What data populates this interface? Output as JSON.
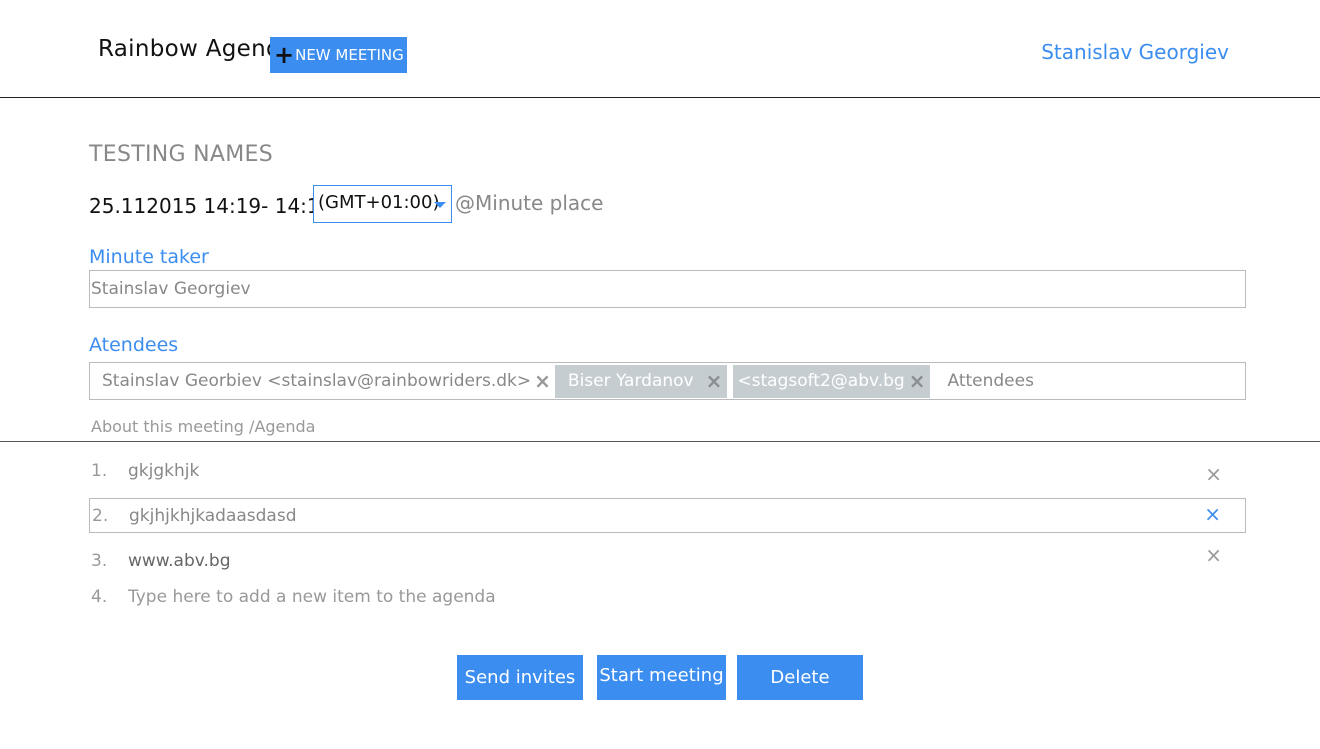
{
  "header": {
    "brand": "Rainbow Agenda",
    "new_meeting_label": "NEW MEETING",
    "user_name": "Stanislav Georgiev"
  },
  "meeting": {
    "title": "TESTING NAMES",
    "datetime": "25.112015 14:19- 14:19",
    "timezone": "(GMT+01:00)",
    "place": "@Minute place"
  },
  "minute_taker": {
    "label": "Minute taker",
    "value": "Stainslav Georgiev"
  },
  "attendees": {
    "label": "Atendees",
    "tags": [
      {
        "text": "Stainslav Georbiev <stainslav@rainbowriders.dk>",
        "style": "plain"
      },
      {
        "text": "Biser Yardanov",
        "style": "gray"
      },
      {
        "text": "<stagsoft2@abv.bg",
        "style": "gray"
      }
    ],
    "placeholder": "Attendees",
    "remove_glyph": "×"
  },
  "agenda": {
    "label": "About this meeting /Agenda",
    "items": [
      {
        "num": "1.",
        "text": "gkjgkhjk"
      },
      {
        "num": "2.",
        "text": "gkjhjkhjkadaasdasd"
      },
      {
        "num": "3.",
        "text": "www.abv.bg"
      }
    ],
    "new_item": {
      "num": "4.",
      "placeholder": "Type here to add a new item to the agenda"
    },
    "remove_glyph": "×"
  },
  "actions": {
    "send_invites": "Send invites",
    "start_meeting": "Start meeting",
    "delete": "Delete"
  },
  "colors": {
    "accent": "#3b8df0",
    "tag_bg": "#c6cdd1"
  },
  "icons": {
    "plus": "plus-icon",
    "dropdown": "caret-down-icon",
    "remove": "close-icon"
  }
}
